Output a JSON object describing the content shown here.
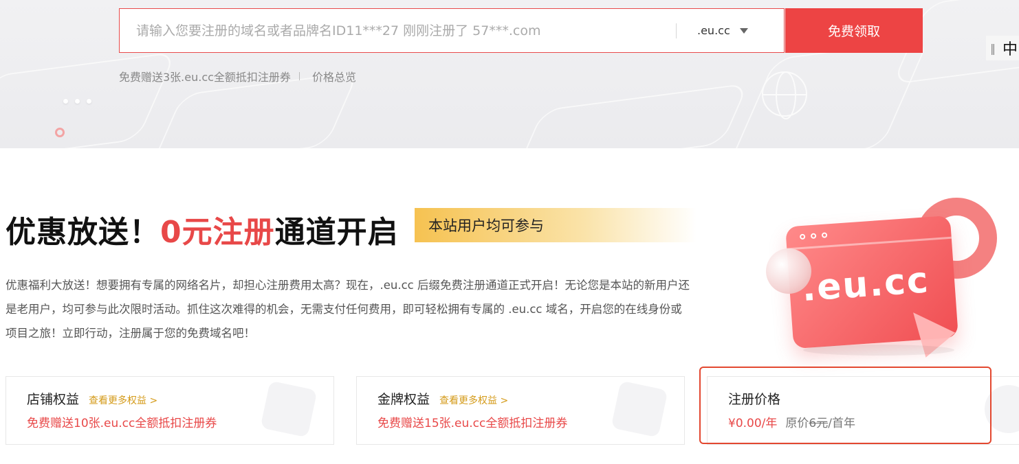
{
  "search": {
    "placeholder": "请输入您要注册的域名或者品牌名ID11***27 刚刚注册了 57***.com",
    "suffix": ".eu.cc",
    "button_label": "免费领取"
  },
  "sublinks": {
    "coupon": "免费赠送3张.eu.cc全额抵扣注册券",
    "prices": "价格总览"
  },
  "language": {
    "label": "中",
    "grip": "‖"
  },
  "promo": {
    "title_part1": "优惠放送！",
    "title_highlight": "0元注册",
    "title_part2": "通道开启",
    "tag": "本站用户均可参与",
    "description": "优惠福利大放送！想要拥有专属的网络名片，却担心注册费用太高？现在，.eu.cc 后缀免费注册通道正式开启！无论您是本站的新用户还是老用户，均可参与此次限时活动。抓住这次难得的机会，无需支付任何费用，即可轻松拥有专属的 .eu.cc 域名，开启您的在线身份或项目之旅！立即行动，注册属于您的免费域名吧！",
    "illustration_label": ".eu.cc"
  },
  "cards": [
    {
      "title": "店铺权益",
      "more": "查看更多权益 >",
      "text": "免费赠送10张.eu.cc全额抵扣注册券"
    },
    {
      "title": "金牌权益",
      "more": "查看更多权益 >",
      "text": "免费赠送15张.eu.cc全额抵扣注册券"
    }
  ],
  "price_card": {
    "title": "注册价格",
    "price": "¥0.00/年",
    "original_prefix": "原价",
    "original_price": "6元",
    "original_suffix": "/首年"
  },
  "colors": {
    "accent": "#ED4444",
    "gold": "#D49A18",
    "highlight_border": "#E3472F"
  }
}
